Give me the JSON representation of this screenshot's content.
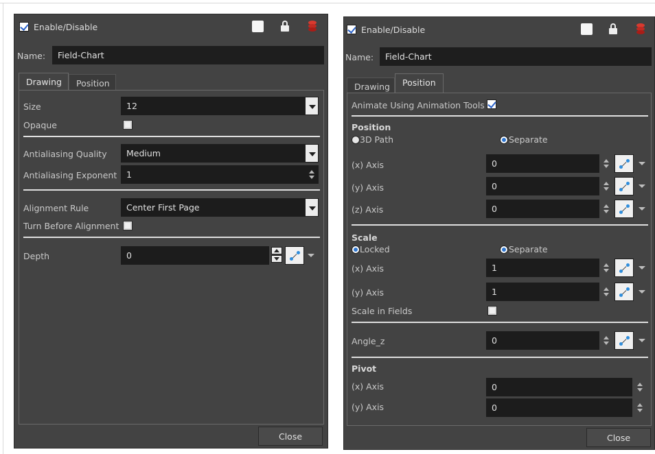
{
  "left": {
    "enable_label": "Enable/Disable",
    "name_label": "Name:",
    "name_value": "Field-Chart",
    "tabs": [
      "Drawing",
      "Position"
    ],
    "size_label": "Size",
    "size_value": "12",
    "opaque_label": "Opaque",
    "aa_quality_label": "Antialiasing Quality",
    "aa_quality_value": "Medium",
    "aa_exponent_label": "Antialiasing Exponent",
    "aa_exponent_value": "1",
    "alignment_label": "Alignment Rule",
    "alignment_value": "Center First Page",
    "turn_label": "Turn Before Alignment",
    "depth_label": "Depth",
    "depth_value": "0",
    "close_label": "Close"
  },
  "right": {
    "enable_label": "Enable/Disable",
    "name_label": "Name:",
    "name_value": "Field-Chart",
    "tabs": [
      "Drawing",
      "Position"
    ],
    "animate_label": "Animate Using Animation Tools",
    "position_title": "Position",
    "path3d_label": "3D Path",
    "separate_label": "Separate",
    "x_axis_label": "(x) Axis",
    "y_axis_label": "(y) Axis",
    "z_axis_label": "(z) Axis",
    "pos_x": "0",
    "pos_y": "0",
    "pos_z": "0",
    "scale_title": "Scale",
    "locked_label": "Locked",
    "scale_separate_label": "Separate",
    "scale_x": "1",
    "scale_y": "1",
    "scale_in_fields_label": "Scale in Fields",
    "angle_label": "Angle_z",
    "angle_value": "0",
    "pivot_title": "Pivot",
    "pivot_x": "0",
    "pivot_y": "0",
    "close_label": "Close"
  },
  "icons": {
    "checkbox": "checkbox-icon",
    "white_square": "color-swatch-icon",
    "lock": "lock-icon",
    "database": "layer-stack-icon",
    "function": "function-curve-icon"
  }
}
